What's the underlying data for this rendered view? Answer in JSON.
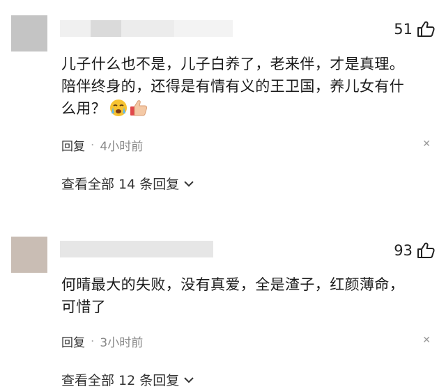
{
  "comments": [
    {
      "likes": "51",
      "text_lines": [
        "儿子什么也不是，儿子白养了，老来伴，才是真理。",
        "陪伴终身的，还得是有情有义的王卫国，养儿女有什",
        "么用？"
      ],
      "emojis": [
        "crying-emoji",
        "thumbs-up-emoji"
      ],
      "reply_label": "回复",
      "separator": "·",
      "time": "4小时前",
      "close_glyph": "✕",
      "expand_label": "查看全部 14 条回复",
      "avatar_color": "#c4c4c4"
    },
    {
      "likes": "93",
      "text_lines": [
        "何晴最大的失败，没有真爱，全是渣子，红颜薄命，",
        "可惜了"
      ],
      "reply_label": "回复",
      "separator": "·",
      "time": "3小时前",
      "close_glyph": "✕",
      "expand_label": "查看全部 12 条回复",
      "avatar_color": "#c9bdb4"
    }
  ]
}
